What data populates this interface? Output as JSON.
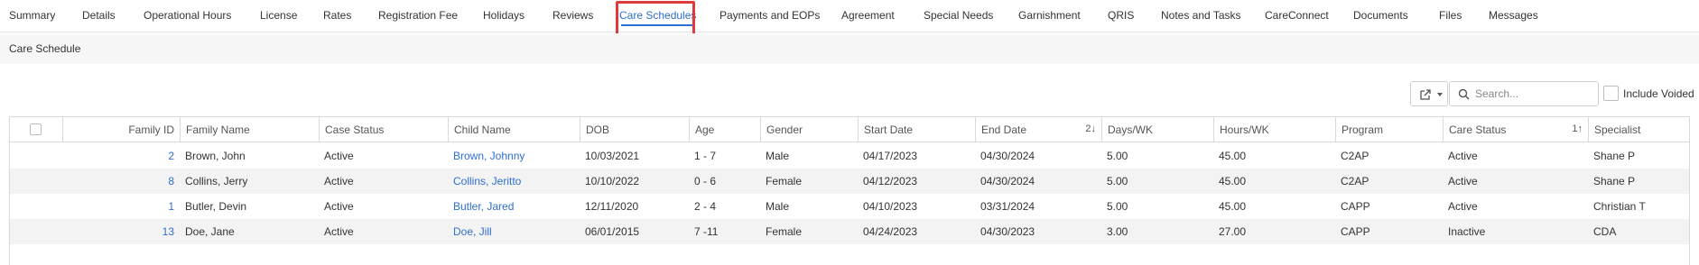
{
  "tabs": [
    {
      "label": "Summary"
    },
    {
      "label": "Details"
    },
    {
      "label": "Operational Hours"
    },
    {
      "label": "License"
    },
    {
      "label": "Rates"
    },
    {
      "label": "Registration Fee"
    },
    {
      "label": "Holidays"
    },
    {
      "label": "Reviews"
    },
    {
      "label": "Care Schedules",
      "active": true
    },
    {
      "label": "Payments and EOPs"
    },
    {
      "label": "Agreement"
    },
    {
      "label": "Special Needs"
    },
    {
      "label": "Garnishment"
    },
    {
      "label": "QRIS"
    },
    {
      "label": "Notes and Tasks"
    },
    {
      "label": "CareConnect"
    },
    {
      "label": "Documents"
    },
    {
      "label": "Files"
    },
    {
      "label": "Messages"
    }
  ],
  "subtab": {
    "label": "Care Schedule"
  },
  "toolbar": {
    "export_icon": "export-icon",
    "search_placeholder": "Search...",
    "include_voided_label": "Include Voided"
  },
  "table": {
    "columns": [
      {
        "label": ""
      },
      {
        "label": "Family ID"
      },
      {
        "label": "Family Name"
      },
      {
        "label": "Case Status"
      },
      {
        "label": "Child Name"
      },
      {
        "label": "DOB"
      },
      {
        "label": "Age"
      },
      {
        "label": "Gender"
      },
      {
        "label": "Start Date"
      },
      {
        "label": "End Date",
        "sort": "2"
      },
      {
        "label": "Days/WK"
      },
      {
        "label": "Hours/WK"
      },
      {
        "label": "Program"
      },
      {
        "label": "Care Status",
        "sort": "1"
      },
      {
        "label": "Specialist"
      }
    ],
    "rows": [
      [
        "2",
        "Brown, John",
        "Active",
        "Brown, Johnny",
        "10/03/2021",
        "1 - 7",
        "Male",
        "04/17/2023",
        "04/30/2024",
        "5.00",
        "45.00",
        "C2AP",
        "Active",
        "Shane P"
      ],
      [
        "8",
        "Collins, Jerry",
        "Active",
        "Collins, Jeritto",
        "10/10/2022",
        "0 - 6",
        "Female",
        "04/12/2023",
        "04/30/2024",
        "5.00",
        "45.00",
        "C2AP",
        "Active",
        "Shane P"
      ],
      [
        "1",
        "Butler, Devin",
        "Active",
        "Butler, Jared",
        "12/11/2020",
        "2 - 4",
        "Male",
        "04/10/2023",
        "03/31/2024",
        "5.00",
        "45.00",
        "CAPP",
        "Active",
        "Christian T"
      ],
      [
        "13",
        "Doe, Jane",
        "Active",
        "Doe, Jill",
        "06/01/2015",
        "7 -11",
        "Female",
        "04/24/2023",
        "04/30/2023",
        "3.00",
        "27.00",
        "CAPP",
        "Inactive",
        "CDA"
      ]
    ]
  }
}
